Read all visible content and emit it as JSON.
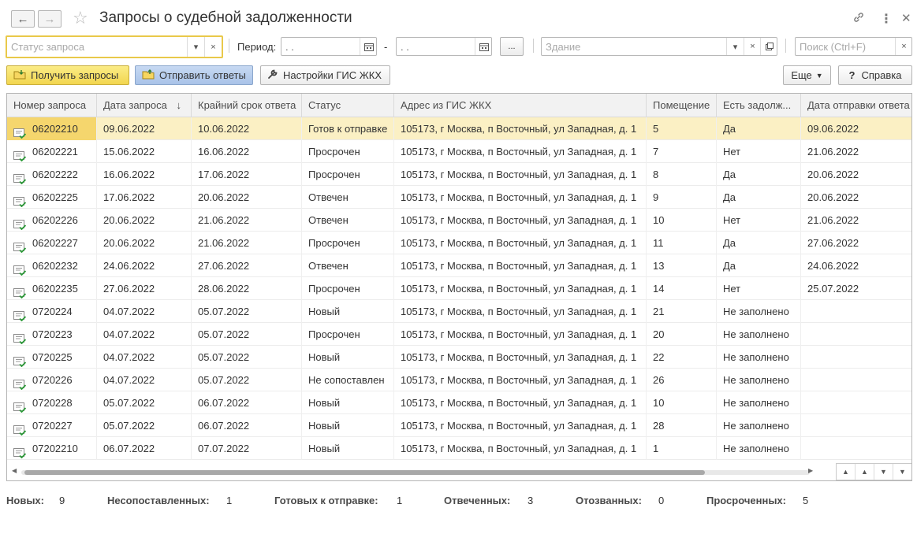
{
  "window": {
    "title": "Запросы о судебной задолженности"
  },
  "filters": {
    "status_placeholder": "Статус запроса",
    "period_label": "Период:",
    "date_from_value": " .  .",
    "date_to_value": " .  .",
    "dash": "-",
    "ellipsis_label": "...",
    "building_placeholder": "Здание",
    "search_placeholder": "Поиск (Ctrl+F)"
  },
  "toolbar": {
    "get_requests": "Получить запросы",
    "send_answers": "Отправить ответы",
    "gis_settings": "Настройки ГИС ЖКХ",
    "more": "Еще",
    "help": "Справка"
  },
  "table": {
    "headers": [
      "Номер запроса",
      "Дата запроса",
      "Крайний срок ответа",
      "Статус",
      "Адрес из ГИС ЖКХ",
      "Помещение",
      "Есть задолж...",
      "Дата отправки ответа"
    ],
    "sort_indicator": "↓",
    "rows": [
      [
        "06202210",
        "09.06.2022",
        "10.06.2022",
        "Готов к отправке",
        "105173, г Москва, п Восточный, ул Западная, д. 1",
        "5",
        "Да",
        "09.06.2022"
      ],
      [
        "06202221",
        "15.06.2022",
        "16.06.2022",
        "Просрочен",
        "105173, г Москва, п Восточный, ул Западная, д. 1",
        "7",
        "Нет",
        "21.06.2022"
      ],
      [
        "06202222",
        "16.06.2022",
        "17.06.2022",
        "Просрочен",
        "105173, г Москва, п Восточный, ул Западная, д. 1",
        "8",
        "Да",
        "20.06.2022"
      ],
      [
        "06202225",
        "17.06.2022",
        "20.06.2022",
        "Отвечен",
        "105173, г Москва, п Восточный, ул Западная, д. 1",
        "9",
        "Да",
        "20.06.2022"
      ],
      [
        "06202226",
        "20.06.2022",
        "21.06.2022",
        "Отвечен",
        "105173, г Москва, п Восточный, ул Западная, д. 1",
        "10",
        "Нет",
        "21.06.2022"
      ],
      [
        "06202227",
        "20.06.2022",
        "21.06.2022",
        "Просрочен",
        "105173, г Москва, п Восточный, ул Западная, д. 1",
        "11",
        "Да",
        "27.06.2022"
      ],
      [
        "06202232",
        "24.06.2022",
        "27.06.2022",
        "Отвечен",
        "105173, г Москва, п Восточный, ул Западная, д. 1",
        "13",
        "Да",
        "24.06.2022"
      ],
      [
        "06202235",
        "27.06.2022",
        "28.06.2022",
        "Просрочен",
        "105173, г Москва, п Восточный, ул Западная, д. 1",
        "14",
        "Нет",
        "25.07.2022"
      ],
      [
        "0720224",
        "04.07.2022",
        "05.07.2022",
        "Новый",
        "105173, г Москва, п Восточный, ул Западная, д. 1",
        "21",
        "Не заполнено",
        ""
      ],
      [
        "0720223",
        "04.07.2022",
        "05.07.2022",
        "Просрочен",
        "105173, г Москва, п Восточный, ул Западная, д. 1",
        "20",
        "Не заполнено",
        ""
      ],
      [
        "0720225",
        "04.07.2022",
        "05.07.2022",
        "Новый",
        "105173, г Москва, п Восточный, ул Западная, д. 1",
        "22",
        "Не заполнено",
        ""
      ],
      [
        "0720226",
        "04.07.2022",
        "05.07.2022",
        "Не сопоставлен",
        "105173, г Москва, п Восточный, ул Западная, д. 1",
        "26",
        "Не заполнено",
        ""
      ],
      [
        "0720228",
        "05.07.2022",
        "06.07.2022",
        "Новый",
        "105173, г Москва, п Восточный, ул Западная, д. 1",
        "10",
        "Не заполнено",
        ""
      ],
      [
        "0720227",
        "05.07.2022",
        "06.07.2022",
        "Новый",
        "105173, г Москва, п Восточный, ул Западная, д. 1",
        "28",
        "Не заполнено",
        ""
      ],
      [
        "07202210",
        "06.07.2022",
        "07.07.2022",
        "Новый",
        "105173, г Москва, п Восточный, ул Западная, д. 1",
        "1",
        "Не заполнено",
        ""
      ]
    ],
    "selected_row": 0
  },
  "footer": [
    {
      "label": "Новых:",
      "value": "9"
    },
    {
      "label": "Несопоставленных:",
      "value": "1"
    },
    {
      "label": "Готовых к отправке:",
      "value": "1"
    },
    {
      "label": "Отвеченных:",
      "value": "3"
    },
    {
      "label": "Отозванных:",
      "value": "0"
    },
    {
      "label": "Просроченных:",
      "value": "5"
    }
  ],
  "colors": {
    "accent_yellow": "#f2d64f",
    "selected_row": "#fbf0c4",
    "focus_border": "#e9c94a"
  },
  "icons": {
    "back": "arrow-left-icon",
    "forward": "arrow-right-icon",
    "favorite": "star-icon",
    "link": "link-icon",
    "more": "kebab-menu-icon",
    "close": "close-icon",
    "calendar": "calendar-icon",
    "row": "document-check-icon"
  }
}
